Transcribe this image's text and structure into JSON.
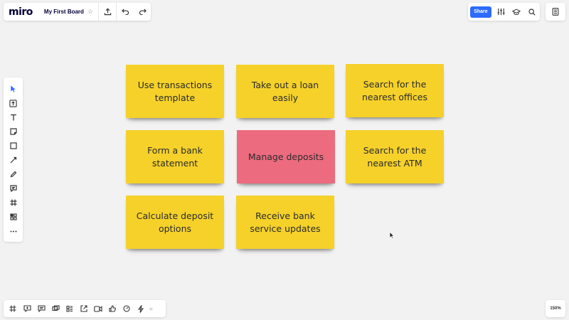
{
  "app": {
    "logo": "miro",
    "board_title": "My First Board",
    "star": "☆"
  },
  "top_right": {
    "share_label": "Share"
  },
  "zoom": {
    "level": "150%"
  },
  "bottom": {
    "collapse": "«"
  },
  "colors": {
    "yellow": "#f5d12a",
    "pink": "#ec6b7e",
    "accent": "#2d6bff"
  },
  "stickies": [
    {
      "text": "Use transactions template",
      "color": "#f5d12a"
    },
    {
      "text": "Take out a loan easily",
      "color": "#f5d12a"
    },
    {
      "text": "Search for the nearest offices",
      "color": "#f5d12a"
    },
    {
      "text": "Form a bank statement",
      "color": "#f5d12a"
    },
    {
      "text": "Manage deposits",
      "color": "#ec6b7e"
    },
    {
      "text": "Search for the nearest ATM",
      "color": "#f5d12a"
    },
    {
      "text": "Calculate deposit options",
      "color": "#f5d12a"
    },
    {
      "text": "Receive bank service updates",
      "color": "#f5d12a"
    }
  ],
  "toolbar_icons": [
    "select-icon",
    "upload-icon",
    "text-icon",
    "sticky-note-icon",
    "shape-icon",
    "line-icon",
    "pen-icon",
    "comment-icon",
    "frame-icon",
    "templates-icon",
    "more-icon"
  ],
  "bottom_icons": [
    "frame-icon",
    "comment-icon",
    "chat-icon",
    "screen-share-icon",
    "cards-icon",
    "export-icon",
    "video-icon",
    "like-icon",
    "timer-icon",
    "lightning-icon"
  ]
}
